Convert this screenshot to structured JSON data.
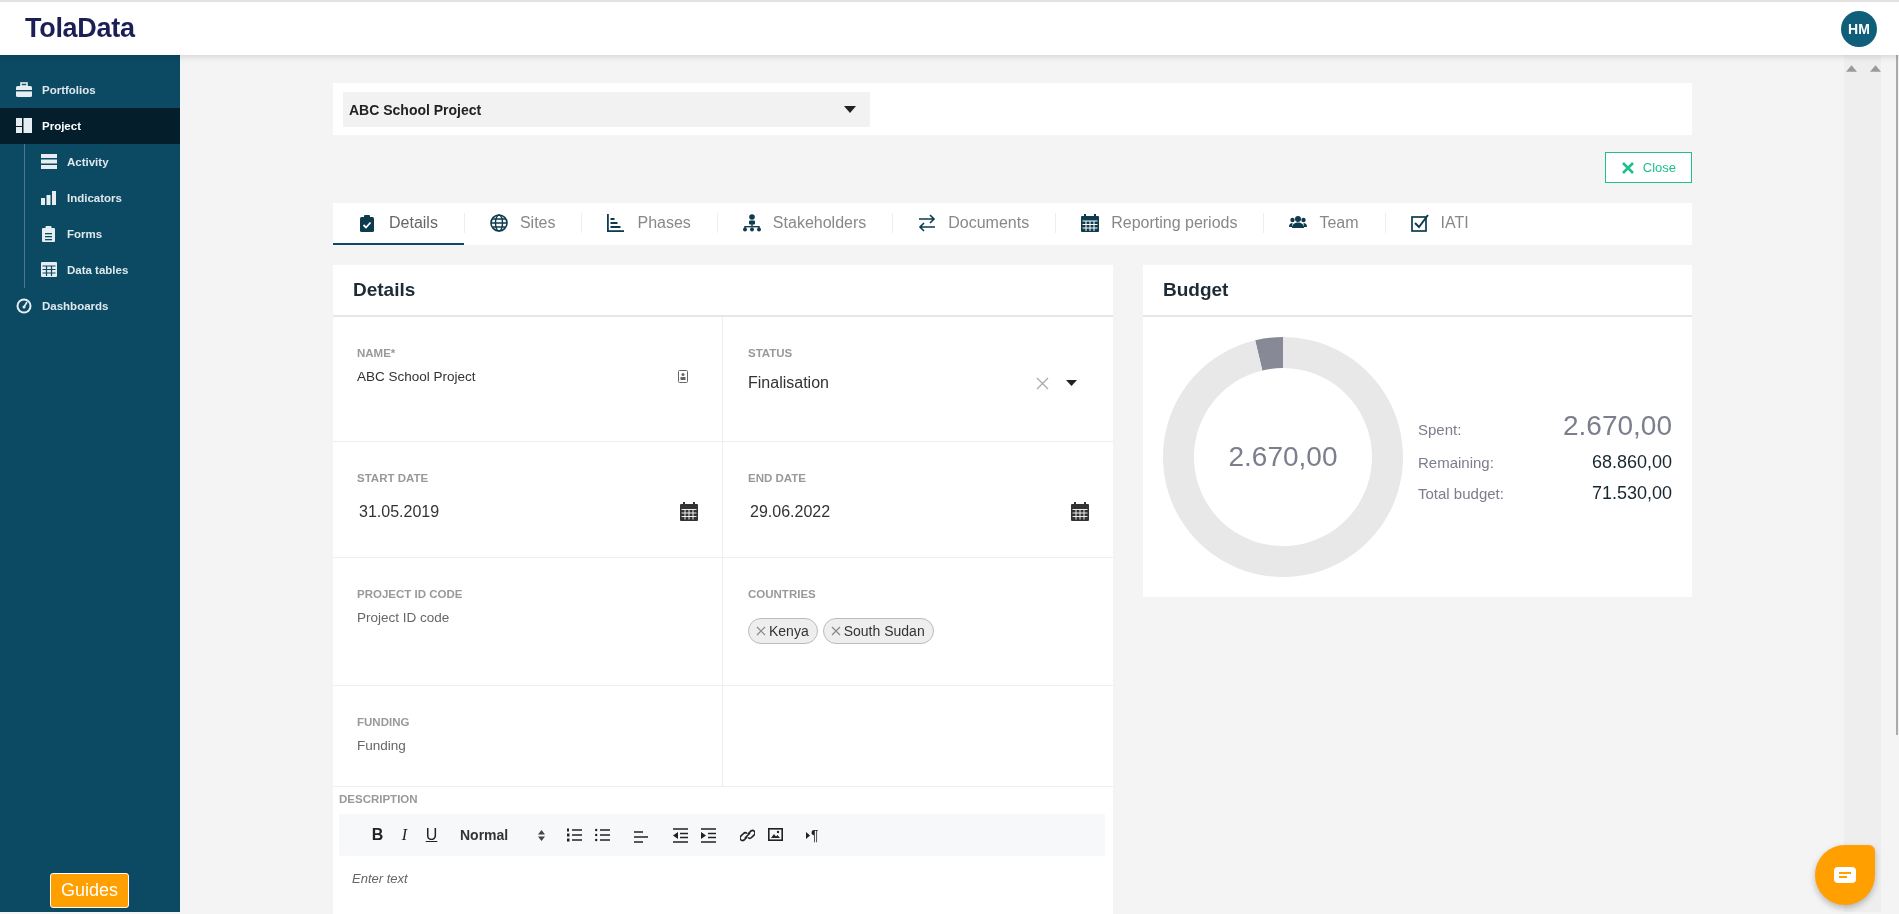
{
  "header": {
    "logo": "TolaData",
    "avatar": "HM"
  },
  "sidebar": {
    "items": [
      {
        "label": "Portfolios",
        "selected": false
      },
      {
        "label": "Project",
        "selected": true,
        "children": [
          {
            "label": "Activity",
            "selected": false
          },
          {
            "label": "Indicators",
            "selected": false
          },
          {
            "label": "Forms",
            "selected": false
          },
          {
            "label": "Data tables",
            "selected": false
          }
        ]
      },
      {
        "label": "Dashboards",
        "selected": false
      }
    ],
    "guides_button": "Guides"
  },
  "project_select": {
    "value": "ABC School Project"
  },
  "close_button": "Close",
  "tabs": [
    {
      "label": "Details",
      "selected": true
    },
    {
      "label": "Sites",
      "selected": false
    },
    {
      "label": "Phases",
      "selected": false
    },
    {
      "label": "Stakeholders",
      "selected": false
    },
    {
      "label": "Documents",
      "selected": false
    },
    {
      "label": "Reporting periods",
      "selected": false
    },
    {
      "label": "Team",
      "selected": false
    },
    {
      "label": "IATI",
      "selected": false
    }
  ],
  "details": {
    "title": "Details",
    "fields": [
      {
        "kind": "text",
        "label": "NAME*",
        "value": "ABC School Project"
      },
      {
        "kind": "select",
        "label": "STATUS",
        "value": "Finalisation"
      },
      {
        "kind": "date",
        "label": "START DATE",
        "value": "31.05.2019"
      },
      {
        "kind": "date",
        "label": "END DATE",
        "value": "29.06.2022"
      },
      {
        "kind": "text",
        "label": "PROJECT ID CODE",
        "placeholder": "Project ID code"
      },
      {
        "kind": "tags",
        "label": "COUNTRIES",
        "tags": [
          "Kenya",
          "South Sudan"
        ]
      },
      {
        "kind": "text",
        "label": "FUNDING",
        "placeholder": "Funding"
      },
      {
        "kind": "empty"
      }
    ],
    "description": {
      "label": "DESCRIPTION",
      "placeholder": "Enter text",
      "toolbar": [
        {
          "kind": "bold",
          "label": "B"
        },
        {
          "kind": "italic",
          "label": "I"
        },
        {
          "kind": "underline",
          "label": "U"
        },
        {
          "kind": "format",
          "label": "Normal"
        },
        {
          "kind": "ordered-list"
        },
        {
          "kind": "bullet-list"
        },
        {
          "kind": "align"
        },
        {
          "kind": "outdent"
        },
        {
          "kind": "indent"
        },
        {
          "kind": "link"
        },
        {
          "kind": "image"
        },
        {
          "kind": "direction",
          "label": "¶"
        }
      ]
    }
  },
  "budget": {
    "title": "Budget",
    "donut": {
      "center": "2.670,00",
      "chart_data": {
        "type": "donut",
        "values": [
          3.73,
          96.27
        ],
        "colors": [
          "#878a96",
          "#e8e8e8"
        ]
      }
    },
    "rows": [
      {
        "label": "Spent:",
        "value": "2.670,00",
        "kind": "primary"
      },
      {
        "label": "Remaining:",
        "value": "68.860,00",
        "kind": "plain"
      },
      {
        "label": "Total budget:",
        "value": "71.530,00",
        "kind": "plain"
      }
    ]
  }
}
